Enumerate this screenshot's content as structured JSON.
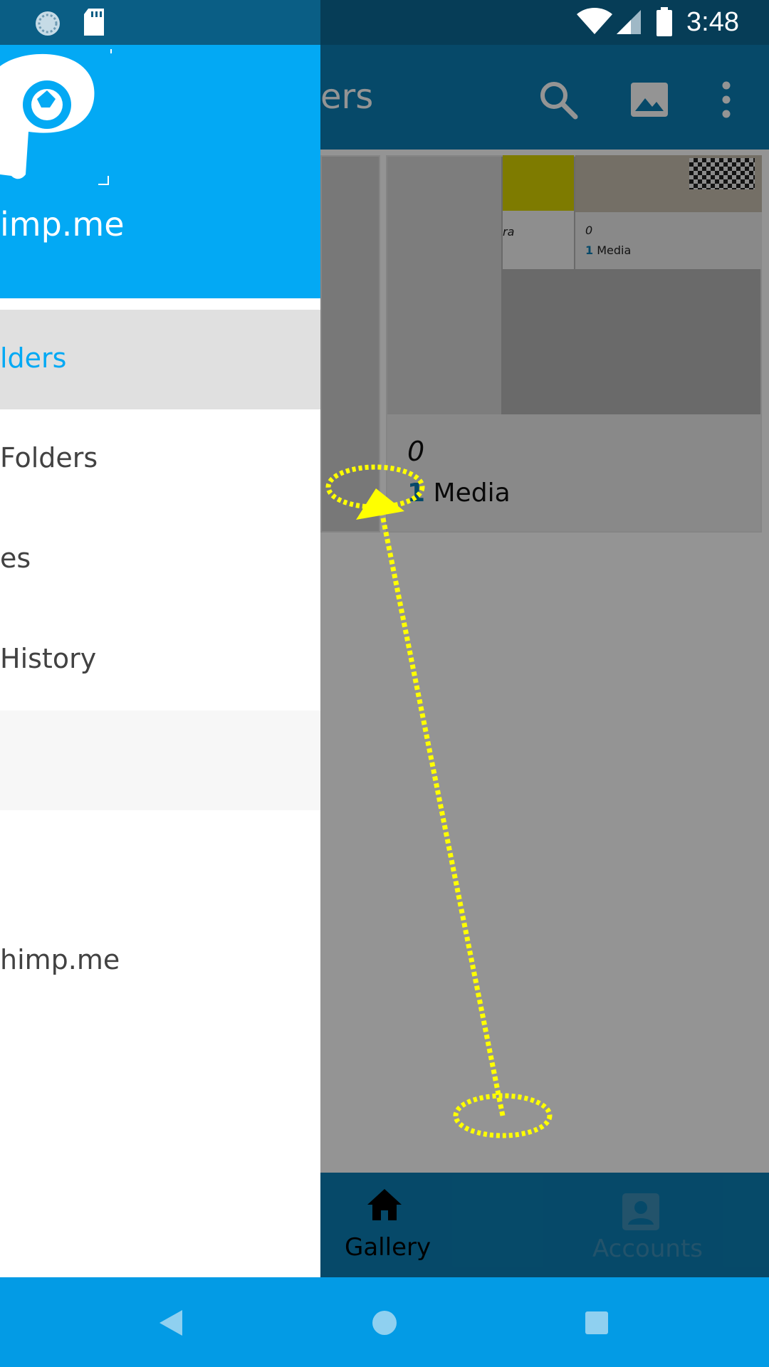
{
  "toolbar": {
    "title": "ers"
  },
  "albums_big": {
    "count": "0",
    "media_number": "1",
    "media_label": " Media"
  },
  "albums_small": {
    "a_label": "ra",
    "b_count": "0",
    "b_media_number": "1",
    "b_media_label": " Media"
  },
  "bottom_nav": {
    "gallery": "Gallery",
    "accounts": "Accounts"
  },
  "status": {
    "time": "3:48"
  },
  "drawer": {
    "header_title": "imp.me",
    "items": [
      {
        "label": "lders"
      },
      {
        "label": "Folders"
      },
      {
        "label": "es"
      },
      {
        "label": "History"
      },
      {
        "label": ""
      },
      {
        "label": "himp.me"
      }
    ]
  },
  "colors": {
    "primary": "#0b7fb5",
    "accent": "#03a9f4",
    "gesture": "#ffff00"
  },
  "icons": [
    "sync-icon",
    "sd-card-icon",
    "wifi-icon",
    "signal-icon",
    "battery-icon",
    "search-icon",
    "image-icon",
    "more-vert-icon",
    "home-icon",
    "account-icon",
    "back-icon",
    "home-circle-icon",
    "recents-icon",
    "app-logo-icon"
  ]
}
